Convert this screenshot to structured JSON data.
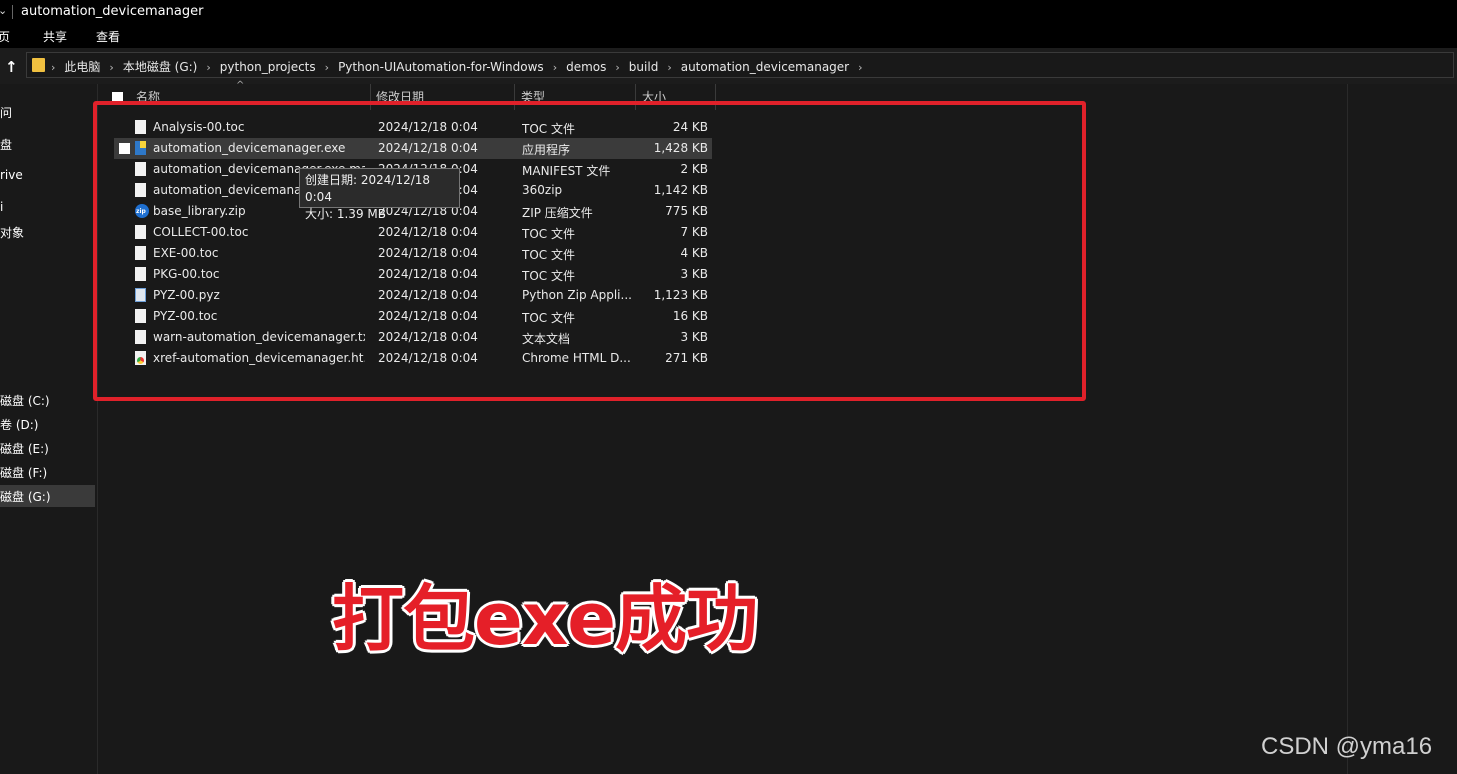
{
  "window": {
    "title": "automation_devicemanager"
  },
  "ribbon": {
    "tabs": [
      "页",
      "共享",
      "查看"
    ]
  },
  "address": {
    "segments": [
      "此电脑",
      "本地磁盘 (G:)",
      "python_projects",
      "Python-UIAutomation-for-Windows",
      "demos",
      "build",
      "automation_devicemanager"
    ]
  },
  "nav": {
    "items": [
      {
        "label": "问",
        "selected": false
      },
      {
        "label": "盘",
        "selected": false
      },
      {
        "label": "rive",
        "selected": false
      },
      {
        "label": "i",
        "selected": false
      },
      {
        "label": "对象",
        "selected": false
      },
      {
        "label": "磁盘 (C:)",
        "selected": false
      },
      {
        "label": "卷 (D:)",
        "selected": false
      },
      {
        "label": "磁盘 (E:)",
        "selected": false
      },
      {
        "label": "磁盘 (F:)",
        "selected": false
      },
      {
        "label": "磁盘 (G:)",
        "selected": true
      }
    ]
  },
  "columns": {
    "name": "名称",
    "date": "修改日期",
    "type": "类型",
    "size": "大小"
  },
  "files": [
    {
      "name": "Analysis-00.toc",
      "date": "2024/12/18 0:04",
      "type": "TOC 文件",
      "size": "24 KB",
      "icon": "file-icon"
    },
    {
      "name": "automation_devicemanager.exe",
      "date": "2024/12/18 0:04",
      "type": "应用程序",
      "size": "1,428 KB",
      "icon": "exe-icon"
    },
    {
      "name": "automation_devicemanager.exe.manifest",
      "date": "2024/12/18 0:04",
      "type": "MANIFEST 文件",
      "size": "2 KB",
      "icon": "file-icon"
    },
    {
      "name": "automation_devicemanager.pkg",
      "date": "2024/12/18 0:04",
      "type": "360zip",
      "size": "1,142 KB",
      "icon": "file-icon"
    },
    {
      "name": "base_library.zip",
      "date": "2024/12/18 0:04",
      "type": "ZIP 压缩文件",
      "size": "775 KB",
      "icon": "zip-icon"
    },
    {
      "name": "COLLECT-00.toc",
      "date": "2024/12/18 0:04",
      "type": "TOC 文件",
      "size": "7 KB",
      "icon": "file-icon"
    },
    {
      "name": "EXE-00.toc",
      "date": "2024/12/18 0:04",
      "type": "TOC 文件",
      "size": "4 KB",
      "icon": "file-icon"
    },
    {
      "name": "PKG-00.toc",
      "date": "2024/12/18 0:04",
      "type": "TOC 文件",
      "size": "3 KB",
      "icon": "file-icon"
    },
    {
      "name": "PYZ-00.pyz",
      "date": "2024/12/18 0:04",
      "type": "Python Zip Appli...",
      "size": "1,123 KB",
      "icon": "pyz-icon"
    },
    {
      "name": "PYZ-00.toc",
      "date": "2024/12/18 0:04",
      "type": "TOC 文件",
      "size": "16 KB",
      "icon": "file-icon"
    },
    {
      "name": "warn-automation_devicemanager.txt",
      "date": "2024/12/18 0:04",
      "type": "文本文档",
      "size": "3 KB",
      "icon": "txt-icon"
    },
    {
      "name": "xref-automation_devicemanager.ht...",
      "date": "2024/12/18 0:04",
      "type": "Chrome HTML D...",
      "size": "271 KB",
      "icon": "chrome-icon"
    }
  ],
  "tooltip": {
    "line1": "创建日期: 2024/12/18 0:04",
    "line2": "大小: 1.39 MB"
  },
  "caption": "打包exe成功",
  "watermark": "CSDN @yma16",
  "colors": {
    "highlight_box": "#e0212a",
    "caption": "#e51f28",
    "background": "#191919"
  }
}
